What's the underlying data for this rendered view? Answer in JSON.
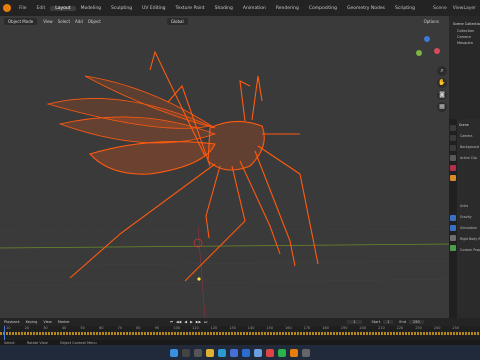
{
  "topbar": {
    "tabs": [
      "Layout",
      "Modeling",
      "Sculpting",
      "UV Editing",
      "Texture Paint",
      "Shading",
      "Animation",
      "Rendering",
      "Compositing",
      "Geometry Nodes",
      "Scripting"
    ],
    "active_tab": "Layout",
    "scene_label": "Scene",
    "view_layer_label": "ViewLayer"
  },
  "viewport": {
    "mode_label": "Object Mode",
    "menus": [
      "View",
      "Select",
      "Add",
      "Object"
    ],
    "orientation": "Global",
    "options_label": "Options"
  },
  "outliner": {
    "title": "Scene Collection",
    "items": [
      "Collection",
      "Camera",
      "Mosquito"
    ]
  },
  "properties": {
    "title": "Scene",
    "rows": [
      "Camera",
      "Background",
      "Active Clip",
      "Units",
      "Gravity",
      "Simulation",
      "Rigid Body World",
      "Custom Properties"
    ]
  },
  "timeline": {
    "playback": "Playback",
    "keying": "Keying",
    "view": "View",
    "marker": "Marker",
    "current_frame": "1",
    "start_label": "Start",
    "start": "1",
    "end_label": "End",
    "end": "250",
    "ticks": [
      "10",
      "20",
      "30",
      "40",
      "50",
      "60",
      "70",
      "80",
      "90",
      "100",
      "110",
      "120",
      "130",
      "140",
      "150",
      "160",
      "170",
      "180",
      "190",
      "200",
      "210",
      "220",
      "230",
      "240",
      "250"
    ]
  },
  "status": {
    "left": "Select",
    "middle": "Rotate View",
    "right": "Object Context Menu"
  },
  "colors": {
    "accent": "#ff6a1a",
    "wire": "#ff5a10",
    "viewport_bg": "#3a3a3a"
  }
}
